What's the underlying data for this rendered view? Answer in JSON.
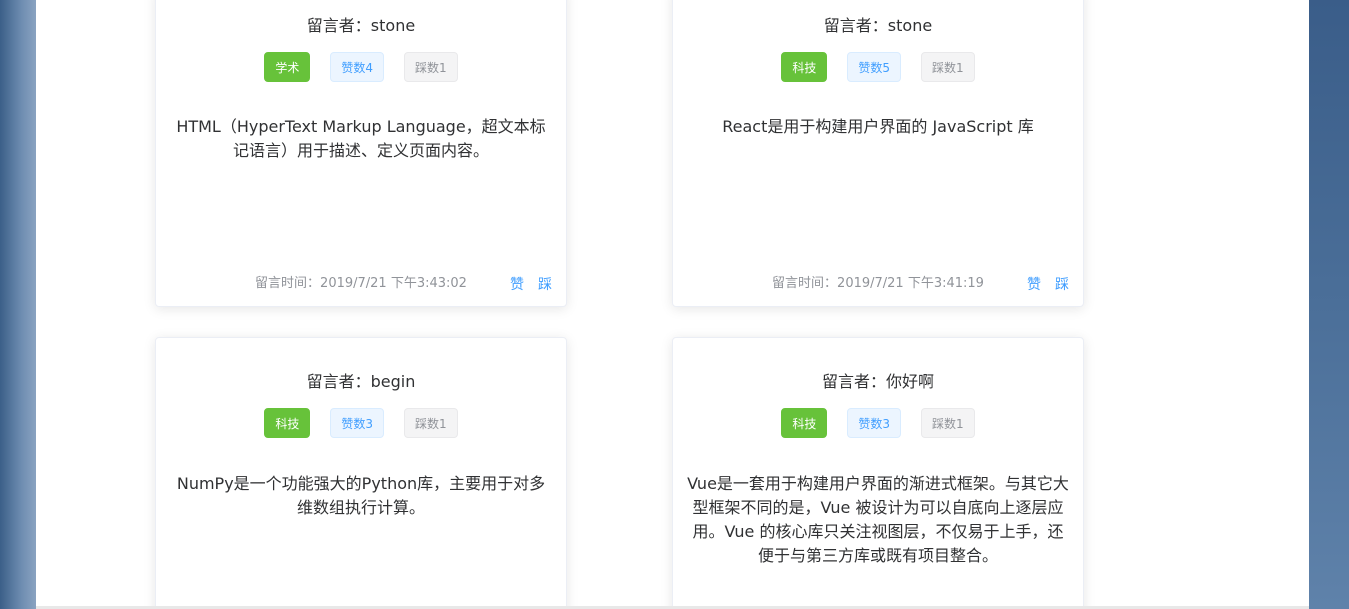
{
  "cards": [
    {
      "author": "留言者：stone",
      "category": "学术",
      "likes": "赞数4",
      "dislikes": "踩数1",
      "content": "HTML（HyperText Markup Language，超文本标记语言）用于描述、定义页面内容。",
      "time": "留言时间：2019/7/21 下午3:43:02",
      "like_action": "赞",
      "dislike_action": "踩"
    },
    {
      "author": "留言者：stone",
      "category": "科技",
      "likes": "赞数5",
      "dislikes": "踩数1",
      "content": "React是用于构建用户界面的 JavaScript 库",
      "time": "留言时间：2019/7/21 下午3:41:19",
      "like_action": "赞",
      "dislike_action": "踩"
    },
    {
      "author": "留言者：begin",
      "category": "科技",
      "likes": "赞数3",
      "dislikes": "踩数1",
      "content": "NumPy是一个功能强大的Python库，主要用于对多维数组执行计算。"
    },
    {
      "author": "留言者：你好啊",
      "category": "科技",
      "likes": "赞数3",
      "dislikes": "踩数1",
      "content": "Vue是一套用于构建用户界面的渐进式框架。与其它大型框架不同的是，Vue 被设计为可以自底向上逐层应用。Vue 的核心库只关注视图层，不仅易于上手，还便于与第三方库或既有项目整合。"
    }
  ],
  "colors": {
    "category_tag": "#67c23a",
    "like_tag": "#409eff",
    "dislike_tag": "#909399",
    "action_link": "#409eff"
  }
}
